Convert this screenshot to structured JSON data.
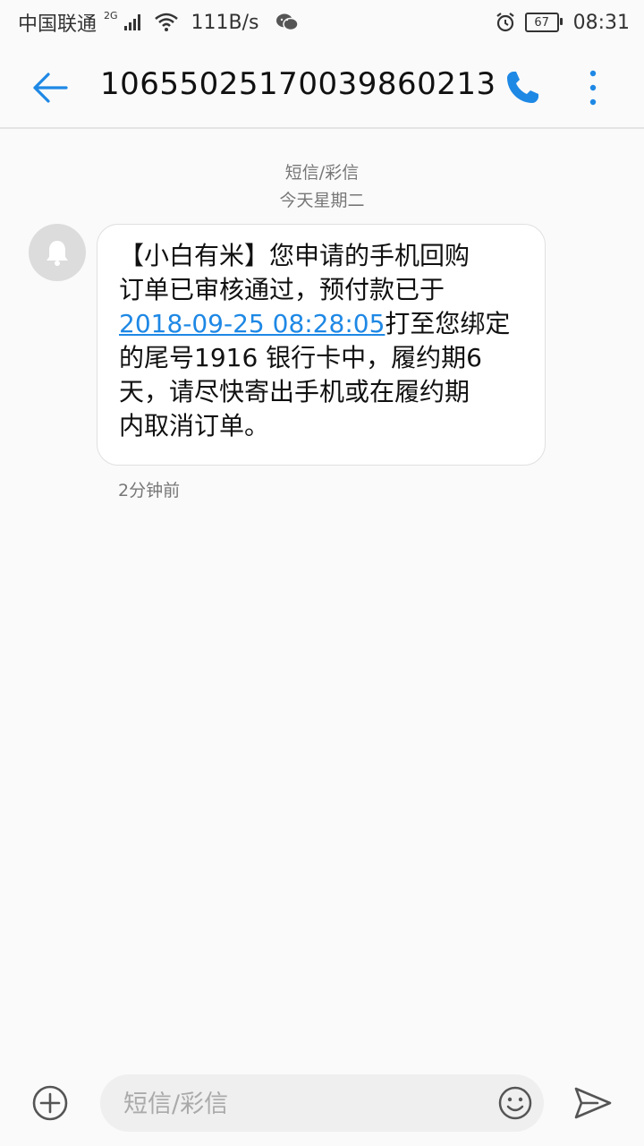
{
  "status_bar": {
    "carrier": "中国联通",
    "network_type": "2G",
    "net_speed": "111B/s",
    "battery": "67",
    "time": "08:31"
  },
  "header": {
    "title": "10655025170039860213"
  },
  "conversation": {
    "type_label": "短信/彩信",
    "date_label": "今天星期二",
    "message": {
      "line1": "【小白有米】您申请的手机回购",
      "line2": "订单已审核通过，预付款已于",
      "datetime_link": "2018-09-25 08:28:05",
      "line3_rest": "打至您绑定",
      "line4": "的尾号1916 银行卡中，履约期6",
      "line5": "天，请尽快寄出手机或在履约期",
      "line6": "内取消订单。",
      "time": "2分钟前"
    }
  },
  "compose": {
    "placeholder": "短信/彩信"
  },
  "colors": {
    "accent": "#1e88e5",
    "background": "#fafafa"
  },
  "icons": [
    "signal-icon",
    "wifi-icon",
    "wechat-icon",
    "alarm-icon",
    "battery-icon",
    "back-arrow-icon",
    "phone-icon",
    "more-vert-icon",
    "bell-icon",
    "add-circle-icon",
    "emoji-icon",
    "send-icon"
  ]
}
